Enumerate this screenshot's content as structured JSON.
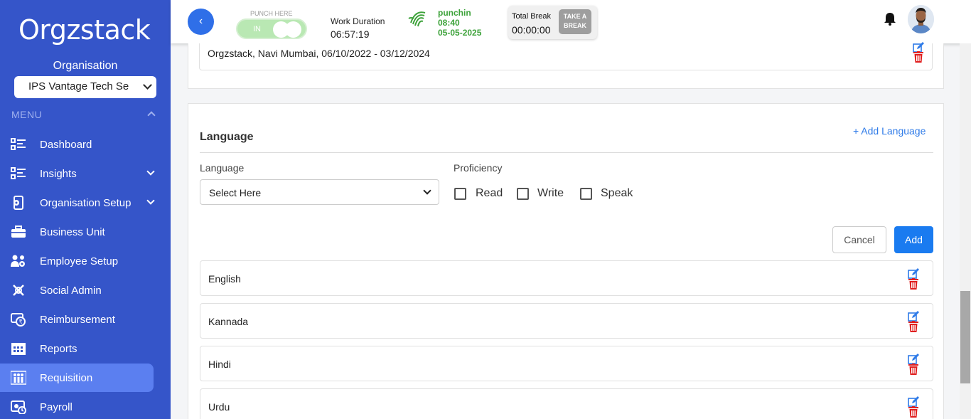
{
  "brand": {
    "logo_text": "Orgzstack"
  },
  "sidebar": {
    "org_label": "Organisation",
    "org_selected": "IPS Vantage Tech Se",
    "menu_heading": "MENU",
    "items": [
      {
        "label": "Dashboard",
        "icon": "dashboard-list-icon",
        "has_submenu": false,
        "active": false
      },
      {
        "label": "Insights",
        "icon": "insights-list-icon",
        "has_submenu": true,
        "active": false
      },
      {
        "label": "Organisation Setup",
        "icon": "organisation-setup-icon",
        "has_submenu": true,
        "active": false
      },
      {
        "label": "Business Unit",
        "icon": "briefcase-icon",
        "has_submenu": false,
        "active": false
      },
      {
        "label": "Employee Setup",
        "icon": "employee-gear-icon",
        "has_submenu": false,
        "active": false
      },
      {
        "label": "Social Admin",
        "icon": "social-admin-icon",
        "has_submenu": false,
        "active": false
      },
      {
        "label": "Reimbursement",
        "icon": "reimbursement-icon",
        "has_submenu": false,
        "active": false
      },
      {
        "label": "Reports",
        "icon": "reports-calendar-icon",
        "has_submenu": false,
        "active": false
      },
      {
        "label": "Requisition",
        "icon": "requisition-people-icon",
        "has_submenu": false,
        "active": true
      },
      {
        "label": "Payroll",
        "icon": "payroll-icon",
        "has_submenu": false,
        "active": false
      }
    ]
  },
  "topbar": {
    "back_label": "‹",
    "punch_label": "PUNCH HERE",
    "punch_state": "IN",
    "work_duration_label": "Work Duration",
    "work_duration_value": "06:57:19",
    "punch_status": "punchin",
    "punch_time": "08:40",
    "punch_date": "05-05-2025",
    "total_break_label": "Total Break",
    "total_break_value": "00:00:00",
    "take_break_line1": "TAKE A",
    "take_break_line2": "BREAK"
  },
  "experience": {
    "entry": "Orgzstack, Navi Mumbai, 06/10/2022 - 03/12/2024"
  },
  "language_section": {
    "title": "Language",
    "add_link": "+ Add Language",
    "language_label": "Language",
    "language_placeholder": "Select Here",
    "proficiency_label": "Proficiency",
    "read_label": "Read",
    "write_label": "Write",
    "speak_label": "Speak",
    "cancel_label": "Cancel",
    "add_label": "Add",
    "languages": [
      "English",
      "Kannada",
      "Hindi",
      "Urdu"
    ]
  },
  "colors": {
    "sidebar_bg": "#3555c9",
    "active_item_bg": "#5b7ff0",
    "primary": "#1a7bf0",
    "punch_green": "#3da23a",
    "delete_red": "#e02020",
    "edit_blue": "#2f7be8"
  }
}
